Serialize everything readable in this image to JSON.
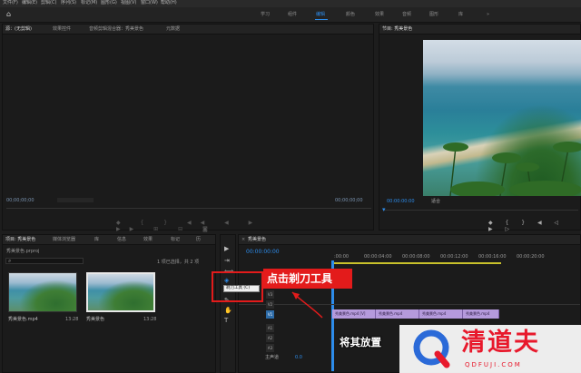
{
  "menu": [
    "文件(F)",
    "编辑(E)",
    "剪辑(C)",
    "序列(S)",
    "标记(M)",
    "图形(G)",
    "视图(V)",
    "窗口(W)",
    "帮助(H)"
  ],
  "workspaces": [
    "学习",
    "组件",
    "编辑",
    "颜色",
    "效果",
    "音频",
    "图形",
    "库"
  ],
  "workspace_more": "»",
  "source_tabs": [
    "源：(无剪辑)",
    "效果控件",
    "音频剪辑混合器：秀美景色",
    "元数据"
  ],
  "source_tc_left": "00;00;00;00",
  "source_tc_right": "00;00;00;00",
  "program_title": "节目: 秀美景色",
  "program_tc": "00:00:00:00",
  "program_fit": "适合",
  "project_tabs": [
    "项目: 秀美景色",
    "媒体浏览器",
    "库",
    "信息",
    "效果",
    "标记",
    "历"
  ],
  "project_file": "秀美景色.prproj",
  "project_count": "1 项已选择，共 2 项",
  "search_icon_glyph": "⌕",
  "clips": [
    {
      "name": "秀美景色.mp4",
      "dur": "13:28"
    },
    {
      "name": "秀美景色",
      "dur": "13:28"
    }
  ],
  "timeline_title": "秀美景色",
  "timeline_tc": "00:00:00:00",
  "ruler": [
    ":00:00",
    "00:00:04:00",
    "00:00:08:00",
    "00:00:12:00",
    "00:00:16:00",
    "00:00:20:00"
  ],
  "video_tracks": [
    "V3",
    "V2",
    "V1"
  ],
  "audio_tracks": [
    "A1",
    "A2",
    "A3"
  ],
  "master_label": "主声道",
  "master_value": "0.0",
  "track_clips": [
    "秀美景色.mp4 [V]",
    "秀美景色.mp4",
    "秀美景色.mp4",
    "秀美景色.mp4"
  ],
  "tooltip": "剃刀工具 (C)",
  "callout": "点击剃刀工具",
  "instruction": "将其放置",
  "watermark": {
    "name": "清道夫",
    "url": "QDFUJI.COM"
  },
  "colors": {
    "accent": "#2d8ceb",
    "annotation": "#e31b1b",
    "clip": "#b59adc",
    "watermark": "#e8192c"
  }
}
